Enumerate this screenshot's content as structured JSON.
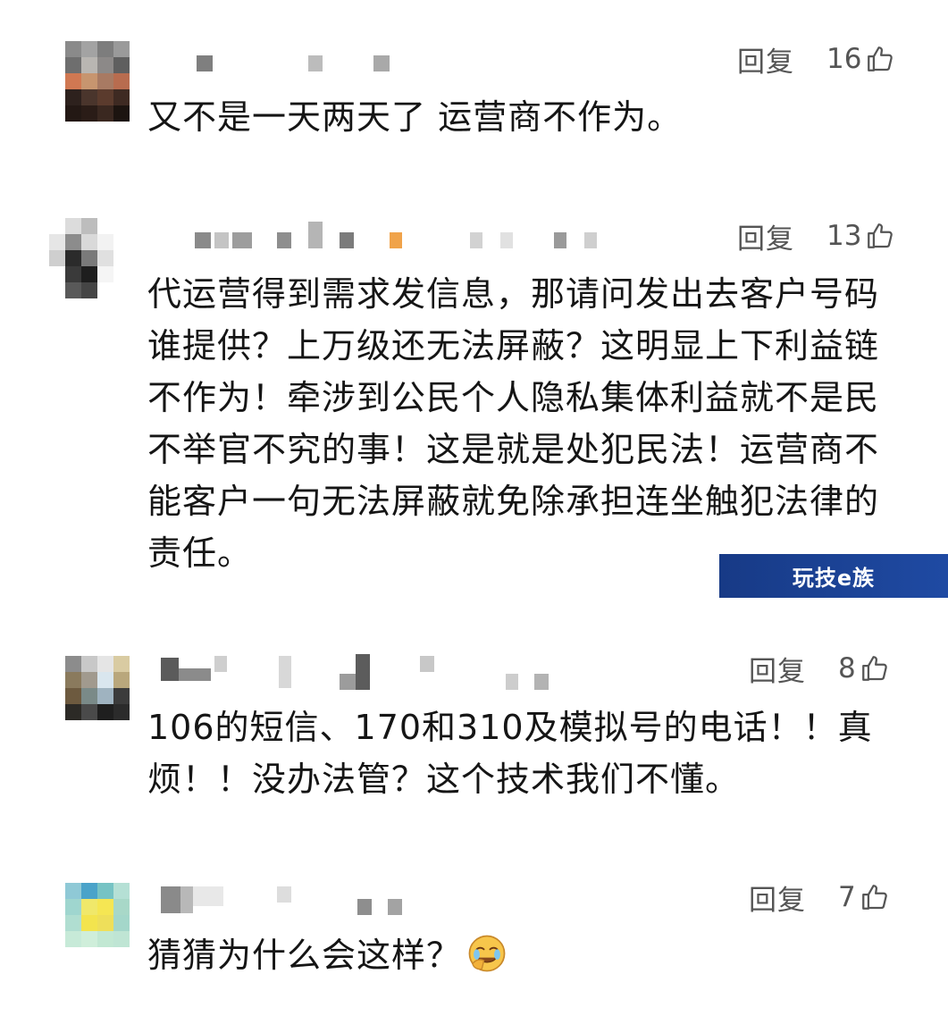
{
  "comments": [
    {
      "reply_label": "回复",
      "likes": "16",
      "text": "又不是一天两天了 运营商不作为。",
      "avatar_colors": [
        "#8a8a8a",
        "#a3a3a3",
        "#7d7d7d",
        "#9a9a9a",
        "#6e6e6e",
        "#b9b6b2",
        "#8c8988",
        "#5f5f5f",
        "#d07852",
        "#c7956f",
        "#a87a63",
        "#b86c4f",
        "#2d211d",
        "#4a352c",
        "#5b3b2d",
        "#3e2a22",
        "#231814",
        "#2a1c17",
        "#3a2820",
        "#1c1410"
      ]
    },
    {
      "reply_label": "回复",
      "likes": "13",
      "text": "代运营得到需求发信息，那请问发出去客户号码谁提供？上万级还无法屏蔽？这明显上下利益链不作为！牵涉到公民个人隐私集体利益就不是民不举官不究的事！这是就是处犯民法！运营商不能客户一句无法屏蔽就免除承担连坐触犯法律的责任。",
      "avatar_colors": [
        "#ffffff",
        "#dcdcdc",
        "#bdbdbd",
        "#ffffff",
        "#e6e6e6",
        "#8c8c8c",
        "#d9d9d9",
        "#f2f2f2",
        "#cfcfcf",
        "#2b2b2b",
        "#7a7a7a",
        "#e0e0e0",
        "#ffffff",
        "#3a3a3a",
        "#1e1e1e",
        "#f5f5f5",
        "#ffffff",
        "#595959",
        "#454545",
        "#ffffff"
      ]
    },
    {
      "reply_label": "回复",
      "likes": "8",
      "text": "106的短信、170和310及模拟号的电话！！真烦！！没办法管？这个技术我们不懂。",
      "avatar_colors": [
        "#8c8c8c",
        "#c8c8c8",
        "#e5e5e5",
        "#d9cba2",
        "#8a7a5d",
        "#a19a8e",
        "#d9e6ee",
        "#b9a77c",
        "#6d5a3f",
        "#7a8a88",
        "#9fb3c0",
        "#3b3b3b",
        "#2c2a26",
        "#4a4a4a",
        "#1f1f1f",
        "#2b2b2b",
        "#ffffff",
        "#ffffff",
        "#ffffff",
        "#ffffff"
      ]
    },
    {
      "reply_label": "回复",
      "likes": "7",
      "text": "猜猜为什么会这样？",
      "avatar_colors": [
        "#8fc9d6",
        "#4aa3c9",
        "#76c3c4",
        "#b5e0d5",
        "#9fd6cf",
        "#f0e86a",
        "#f5e653",
        "#a8d8c8",
        "#b0ded1",
        "#f3e44e",
        "#eedf5a",
        "#a4d7ca",
        "#c7ead8",
        "#cfeeda",
        "#c2e8d3",
        "#bfe5d4",
        "#ffffff",
        "#ffffff",
        "#ffffff",
        "#ffffff"
      ]
    }
  ],
  "watermark": "玩技e族",
  "colors": {
    "watermark_bg": "#1f4aa3",
    "action_text": "#555555",
    "body_text": "#151515"
  },
  "icons": {
    "like": "thumbs-up-icon",
    "emoji": "facepalm-laugh-emoji-icon"
  }
}
